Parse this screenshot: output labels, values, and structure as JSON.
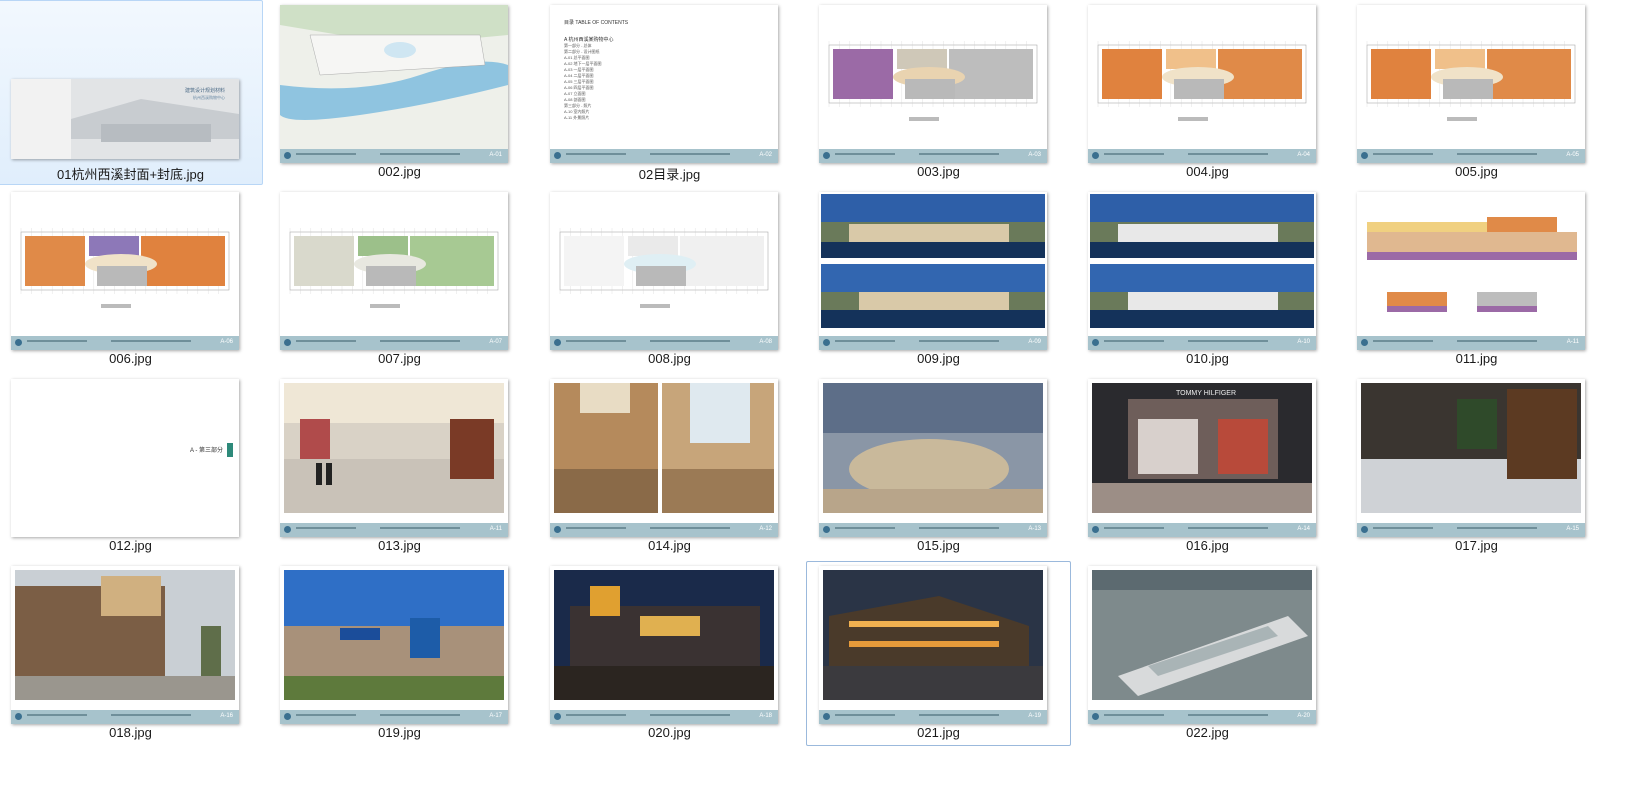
{
  "files": [
    {
      "name": "01杭州西溪封面+封底.jpg",
      "kind": "cover",
      "selected": true
    },
    {
      "name": "002.jpg",
      "kind": "siteplan",
      "page": "A-01"
    },
    {
      "name": "02目录.jpg",
      "kind": "toc",
      "page": "A-02"
    },
    {
      "name": "003.jpg",
      "kind": "plan-purple",
      "page": "A-03"
    },
    {
      "name": "004.jpg",
      "kind": "plan-orange",
      "page": "A-04"
    },
    {
      "name": "005.jpg",
      "kind": "plan-orange",
      "page": "A-05"
    },
    {
      "name": "006.jpg",
      "kind": "plan-orange2",
      "page": "A-06"
    },
    {
      "name": "007.jpg",
      "kind": "plan-green",
      "page": "A-07"
    },
    {
      "name": "008.jpg",
      "kind": "plan-white",
      "page": "A-08"
    },
    {
      "name": "009.jpg",
      "kind": "elevation",
      "page": "A-09"
    },
    {
      "name": "010.jpg",
      "kind": "elevation2",
      "page": "A-10"
    },
    {
      "name": "011.jpg",
      "kind": "section",
      "page": "A-11"
    },
    {
      "name": "012.jpg",
      "kind": "divider"
    },
    {
      "name": "013.jpg",
      "kind": "photo-atrium",
      "page": "A-11"
    },
    {
      "name": "014.jpg",
      "kind": "photo-split",
      "page": "A-12"
    },
    {
      "name": "015.jpg",
      "kind": "photo-interior",
      "page": "A-13"
    },
    {
      "name": "016.jpg",
      "kind": "photo-store",
      "page": "A-14"
    },
    {
      "name": "017.jpg",
      "kind": "photo-cafe",
      "page": "A-15"
    },
    {
      "name": "018.jpg",
      "kind": "photo-exterior",
      "page": "A-16"
    },
    {
      "name": "019.jpg",
      "kind": "photo-sams",
      "page": "A-17"
    },
    {
      "name": "020.jpg",
      "kind": "photo-night",
      "page": "A-18"
    },
    {
      "name": "021.jpg",
      "kind": "photo-night2",
      "page": "A-19",
      "hover": true
    },
    {
      "name": "022.jpg",
      "kind": "photo-aerial",
      "page": "A-20"
    }
  ],
  "texts": {
    "cover_title": "建筑设计规划材料",
    "cover_sub": "杭州西溪购物中心",
    "toc_heading": "目录  TABLE OF CONTENTS",
    "toc_section_a": "A 杭州西溪某购物中心",
    "divider_label": "A - 第三部分"
  },
  "toc_lines": [
    "第一部分 - 总体",
    "第二部分 - 设计图纸",
    "A-01  总平面图",
    "A-02  地下一层平面图",
    "A-03  一层平面图",
    "A-04  二层平面图",
    "A-05  三层平面图",
    "A-06  四层平面图",
    "A-07  立面图",
    "A-08  剖面图",
    "第三部分 - 照片",
    "A-10  室内照片",
    "A-11  外景照片"
  ]
}
